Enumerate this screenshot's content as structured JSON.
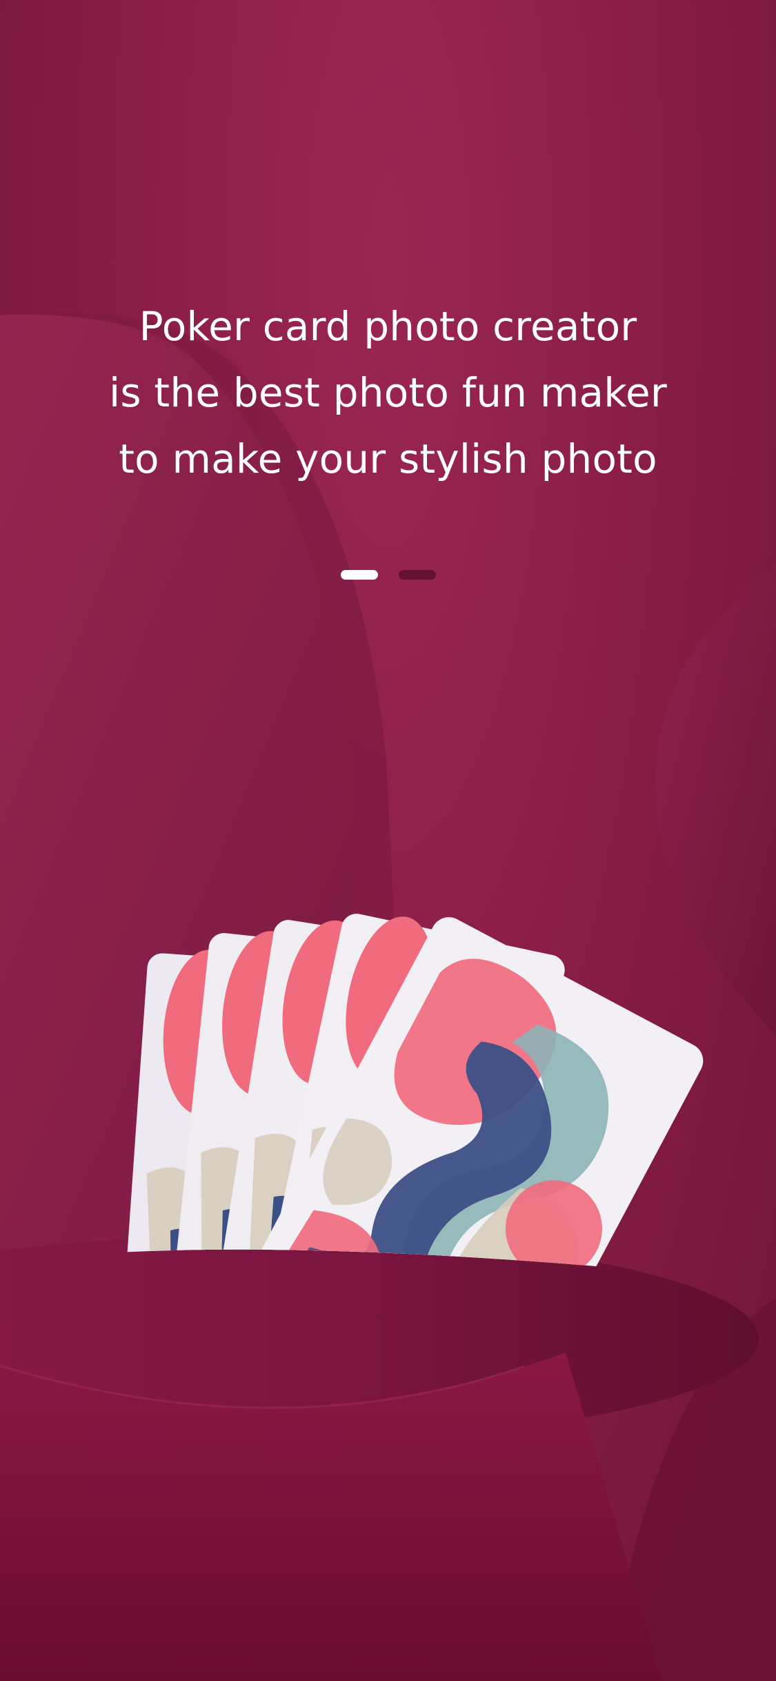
{
  "onboarding": {
    "headline_lines": [
      "Poker card photo creator",
      "is the best photo fun maker",
      "to make your stylish photo"
    ],
    "pager": {
      "total": 2,
      "current": 1
    },
    "colors": {
      "background": "#8e1f47",
      "text": "#ffffff",
      "card_pink": "#f06b7e",
      "card_navy": "#3c4f86",
      "card_teal": "#8db4b6",
      "card_beige": "#d7cdbd"
    }
  }
}
